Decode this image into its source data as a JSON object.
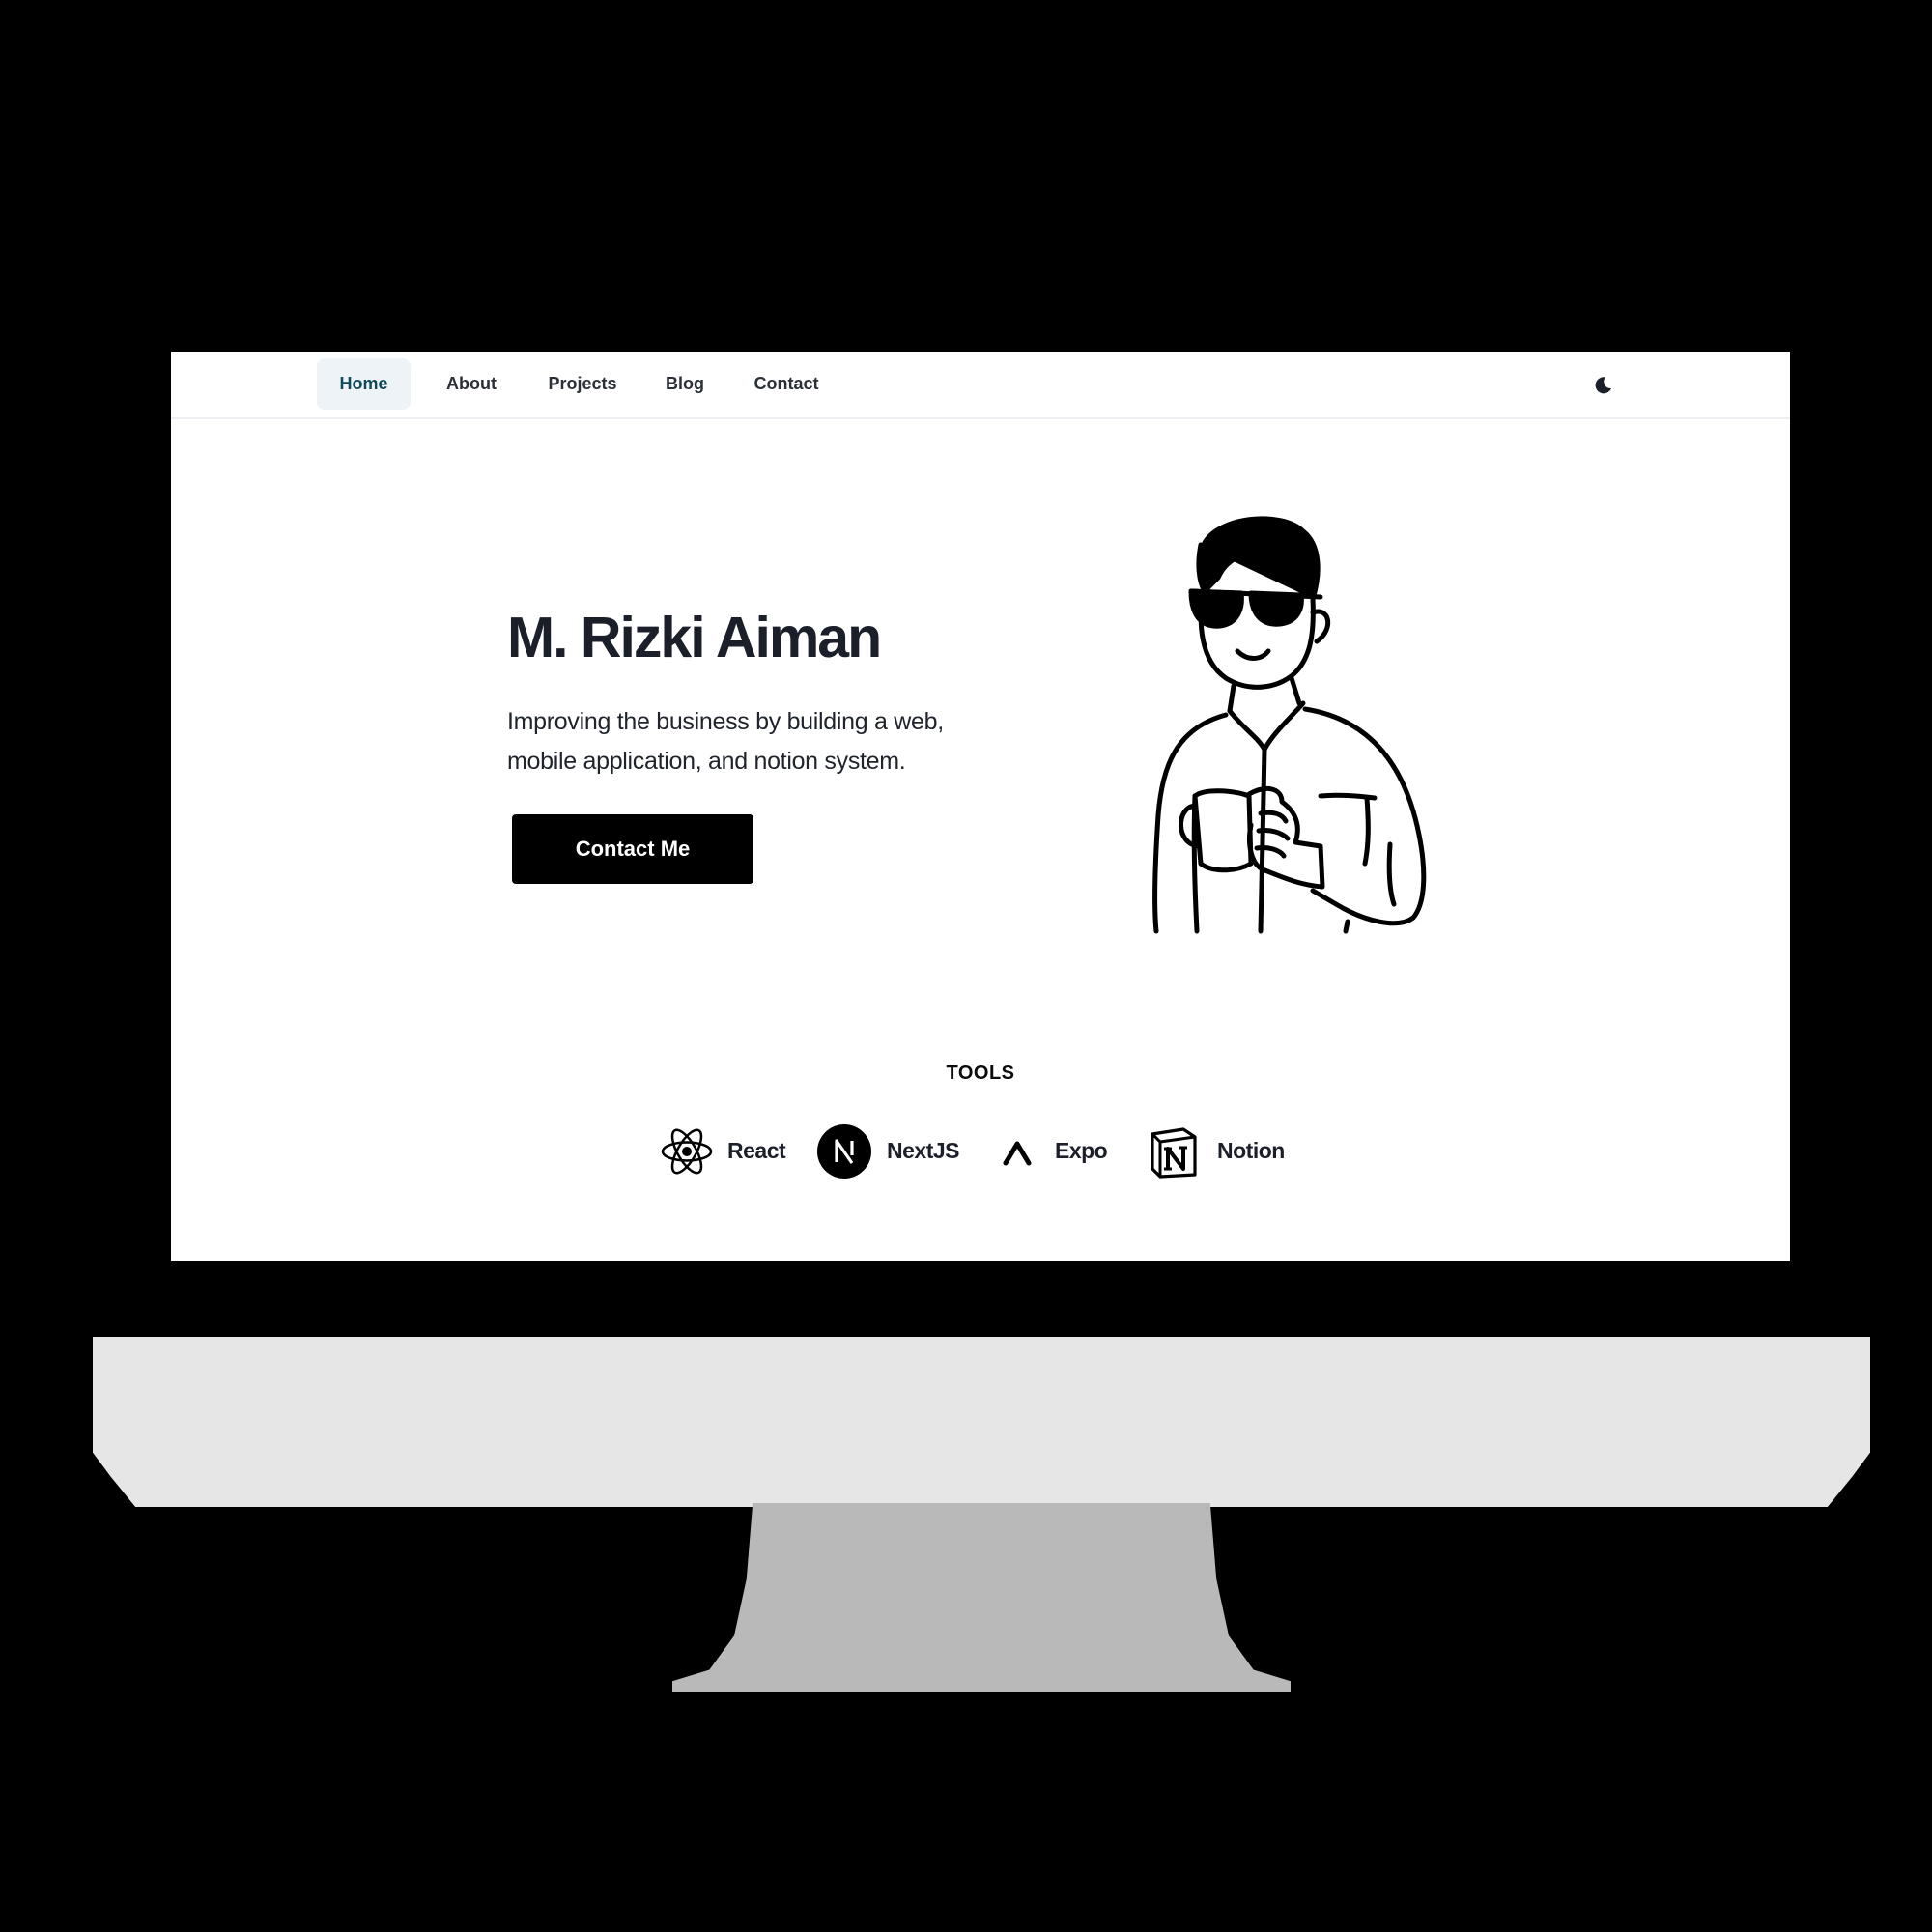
{
  "nav": {
    "items": [
      {
        "label": "Home",
        "active": true
      },
      {
        "label": "About",
        "active": false
      },
      {
        "label": "Projects",
        "active": false
      },
      {
        "label": "Blog",
        "active": false
      },
      {
        "label": "Contact",
        "active": false
      }
    ],
    "theme_toggle_icon": "moon-icon"
  },
  "hero": {
    "name": "M. Rizki Aiman",
    "tagline": "Improving the business by building a web, mobile application, and notion system.",
    "cta_label": "Contact Me",
    "illustration": "man-with-sunglasses-holding-mug-illustration"
  },
  "tools": {
    "title": "TOOLS",
    "items": [
      {
        "label": "React",
        "icon": "react-icon"
      },
      {
        "label": "NextJS",
        "icon": "nextjs-icon"
      },
      {
        "label": "Expo",
        "icon": "expo-icon"
      },
      {
        "label": "Notion",
        "icon": "notion-icon"
      }
    ]
  },
  "colors": {
    "background": "#000000",
    "page": "#ffffff",
    "active_nav_bg": "#eef3f7",
    "active_nav_text": "#0f4a5c",
    "text": "#1b1f29",
    "button_bg": "#000000",
    "monitor_chin": "#e6e6e6",
    "monitor_stand": "#b9b9b9"
  }
}
